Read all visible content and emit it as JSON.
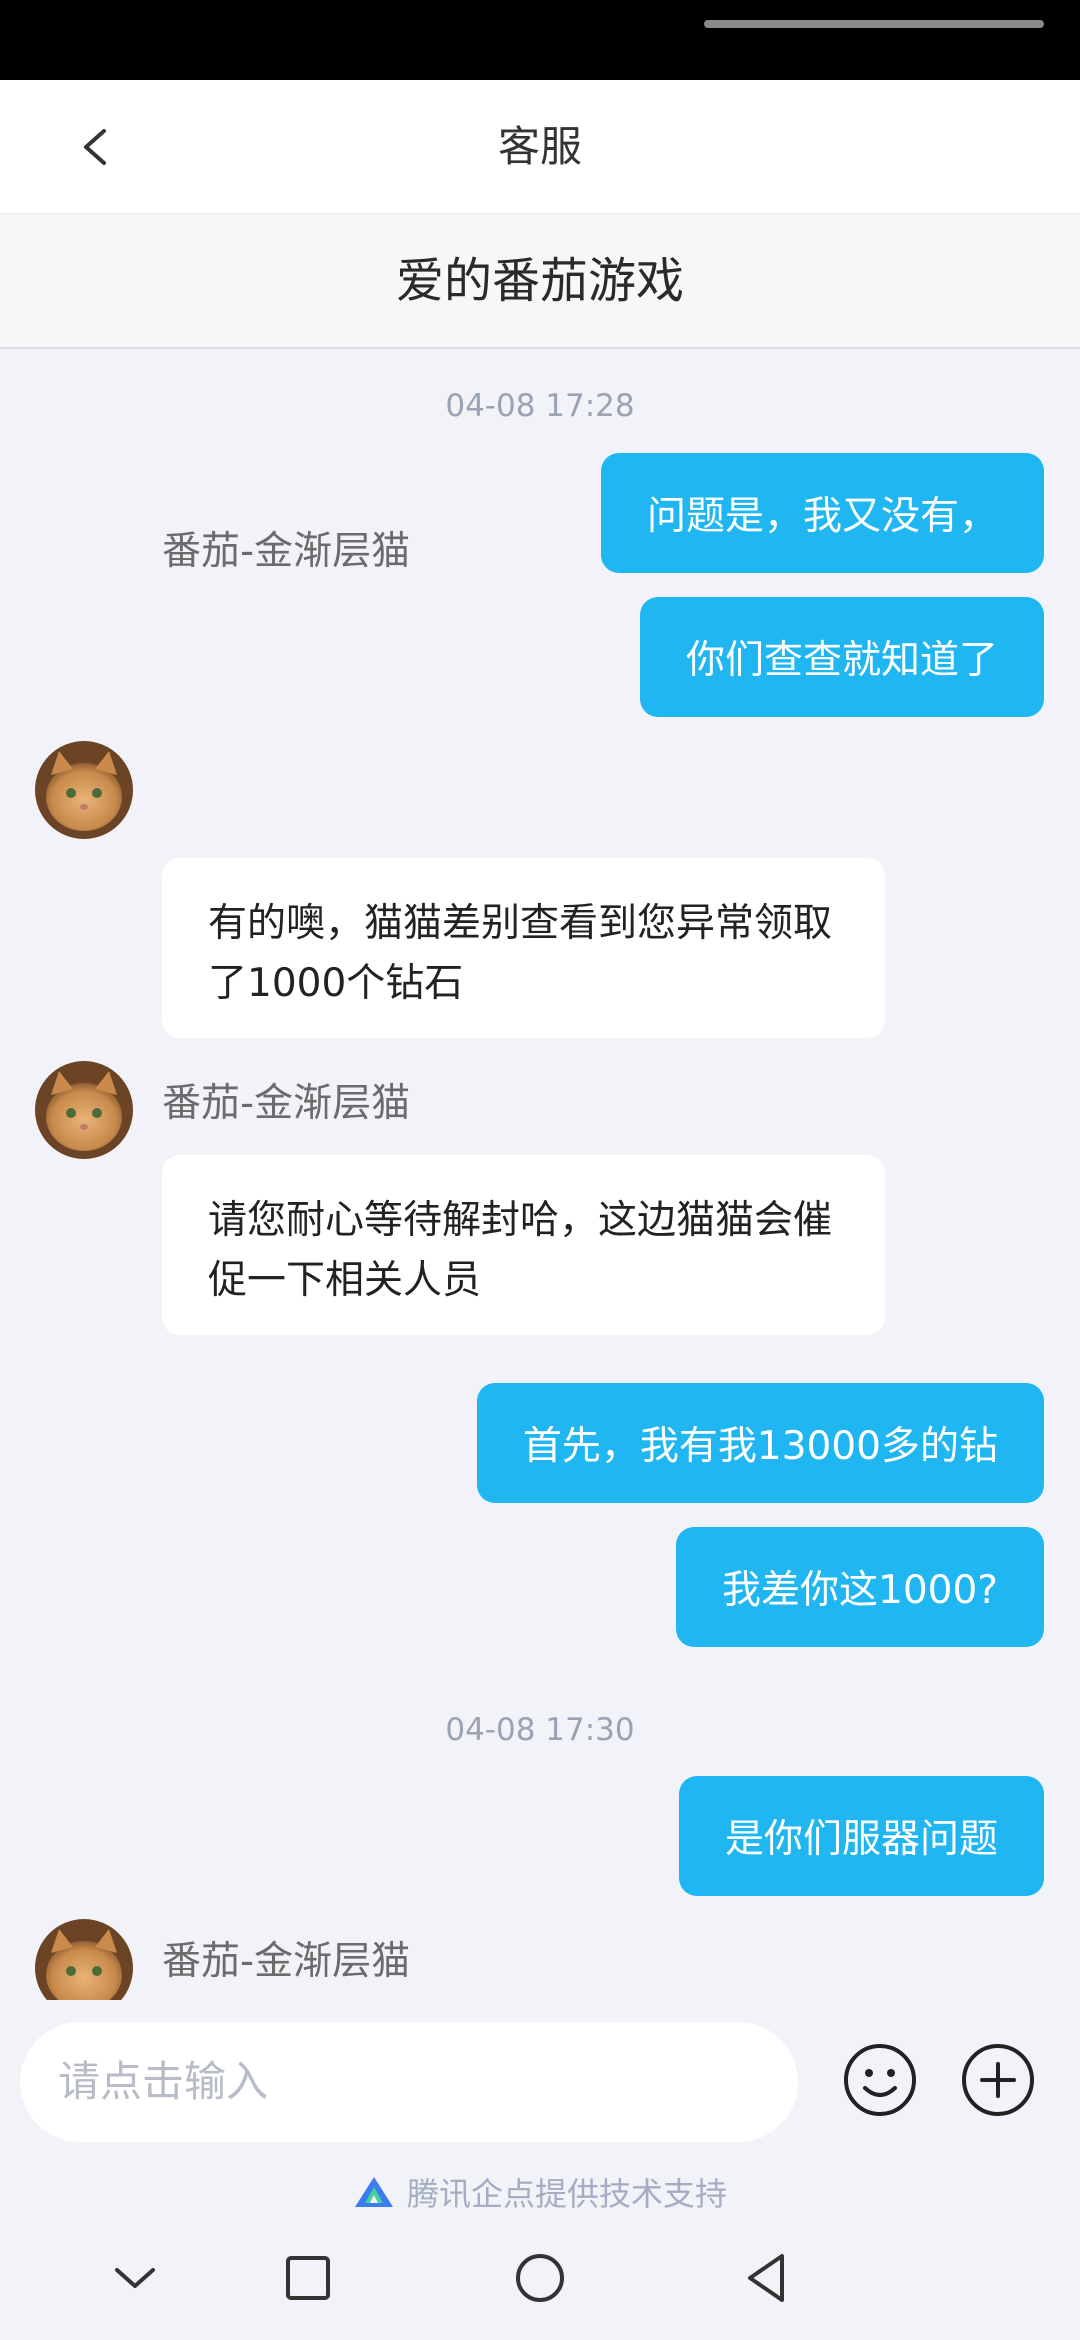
{
  "header": {
    "title": "客服",
    "back_icon": "chevron-left-icon"
  },
  "subheader": {
    "title": "爱的番茄游戏"
  },
  "chat": {
    "timestamps": [
      "04-08 17:28",
      "04-08 17:30"
    ],
    "outgoing": [
      "问题是，我又没有，",
      "你们查查就知道了",
      "首先，我有我13000多的钻",
      "我差你这1000?",
      "是你们服器问题"
    ],
    "incoming": [
      {
        "sender": "番茄-金渐层猫",
        "text": "有的噢，猫猫差别查看到您异常领取了1000个钻石"
      },
      {
        "sender": "番茄-金渐层猫",
        "text": "请您耐心等待解封哈，这边猫猫会催促一下相关人员"
      },
      {
        "sender": "番茄-金渐层猫",
        "text": ""
      }
    ],
    "bubble_color": "#1fb6f2"
  },
  "composer": {
    "placeholder": "请点击输入",
    "emoji_icon": "smiley-icon",
    "add_icon": "plus-circle-icon"
  },
  "footer": {
    "powered_by": "腾讯企点提供技术支持"
  },
  "navbar": {
    "icons": [
      "chevron-down-icon",
      "square-icon",
      "circle-icon",
      "triangle-back-icon"
    ]
  }
}
